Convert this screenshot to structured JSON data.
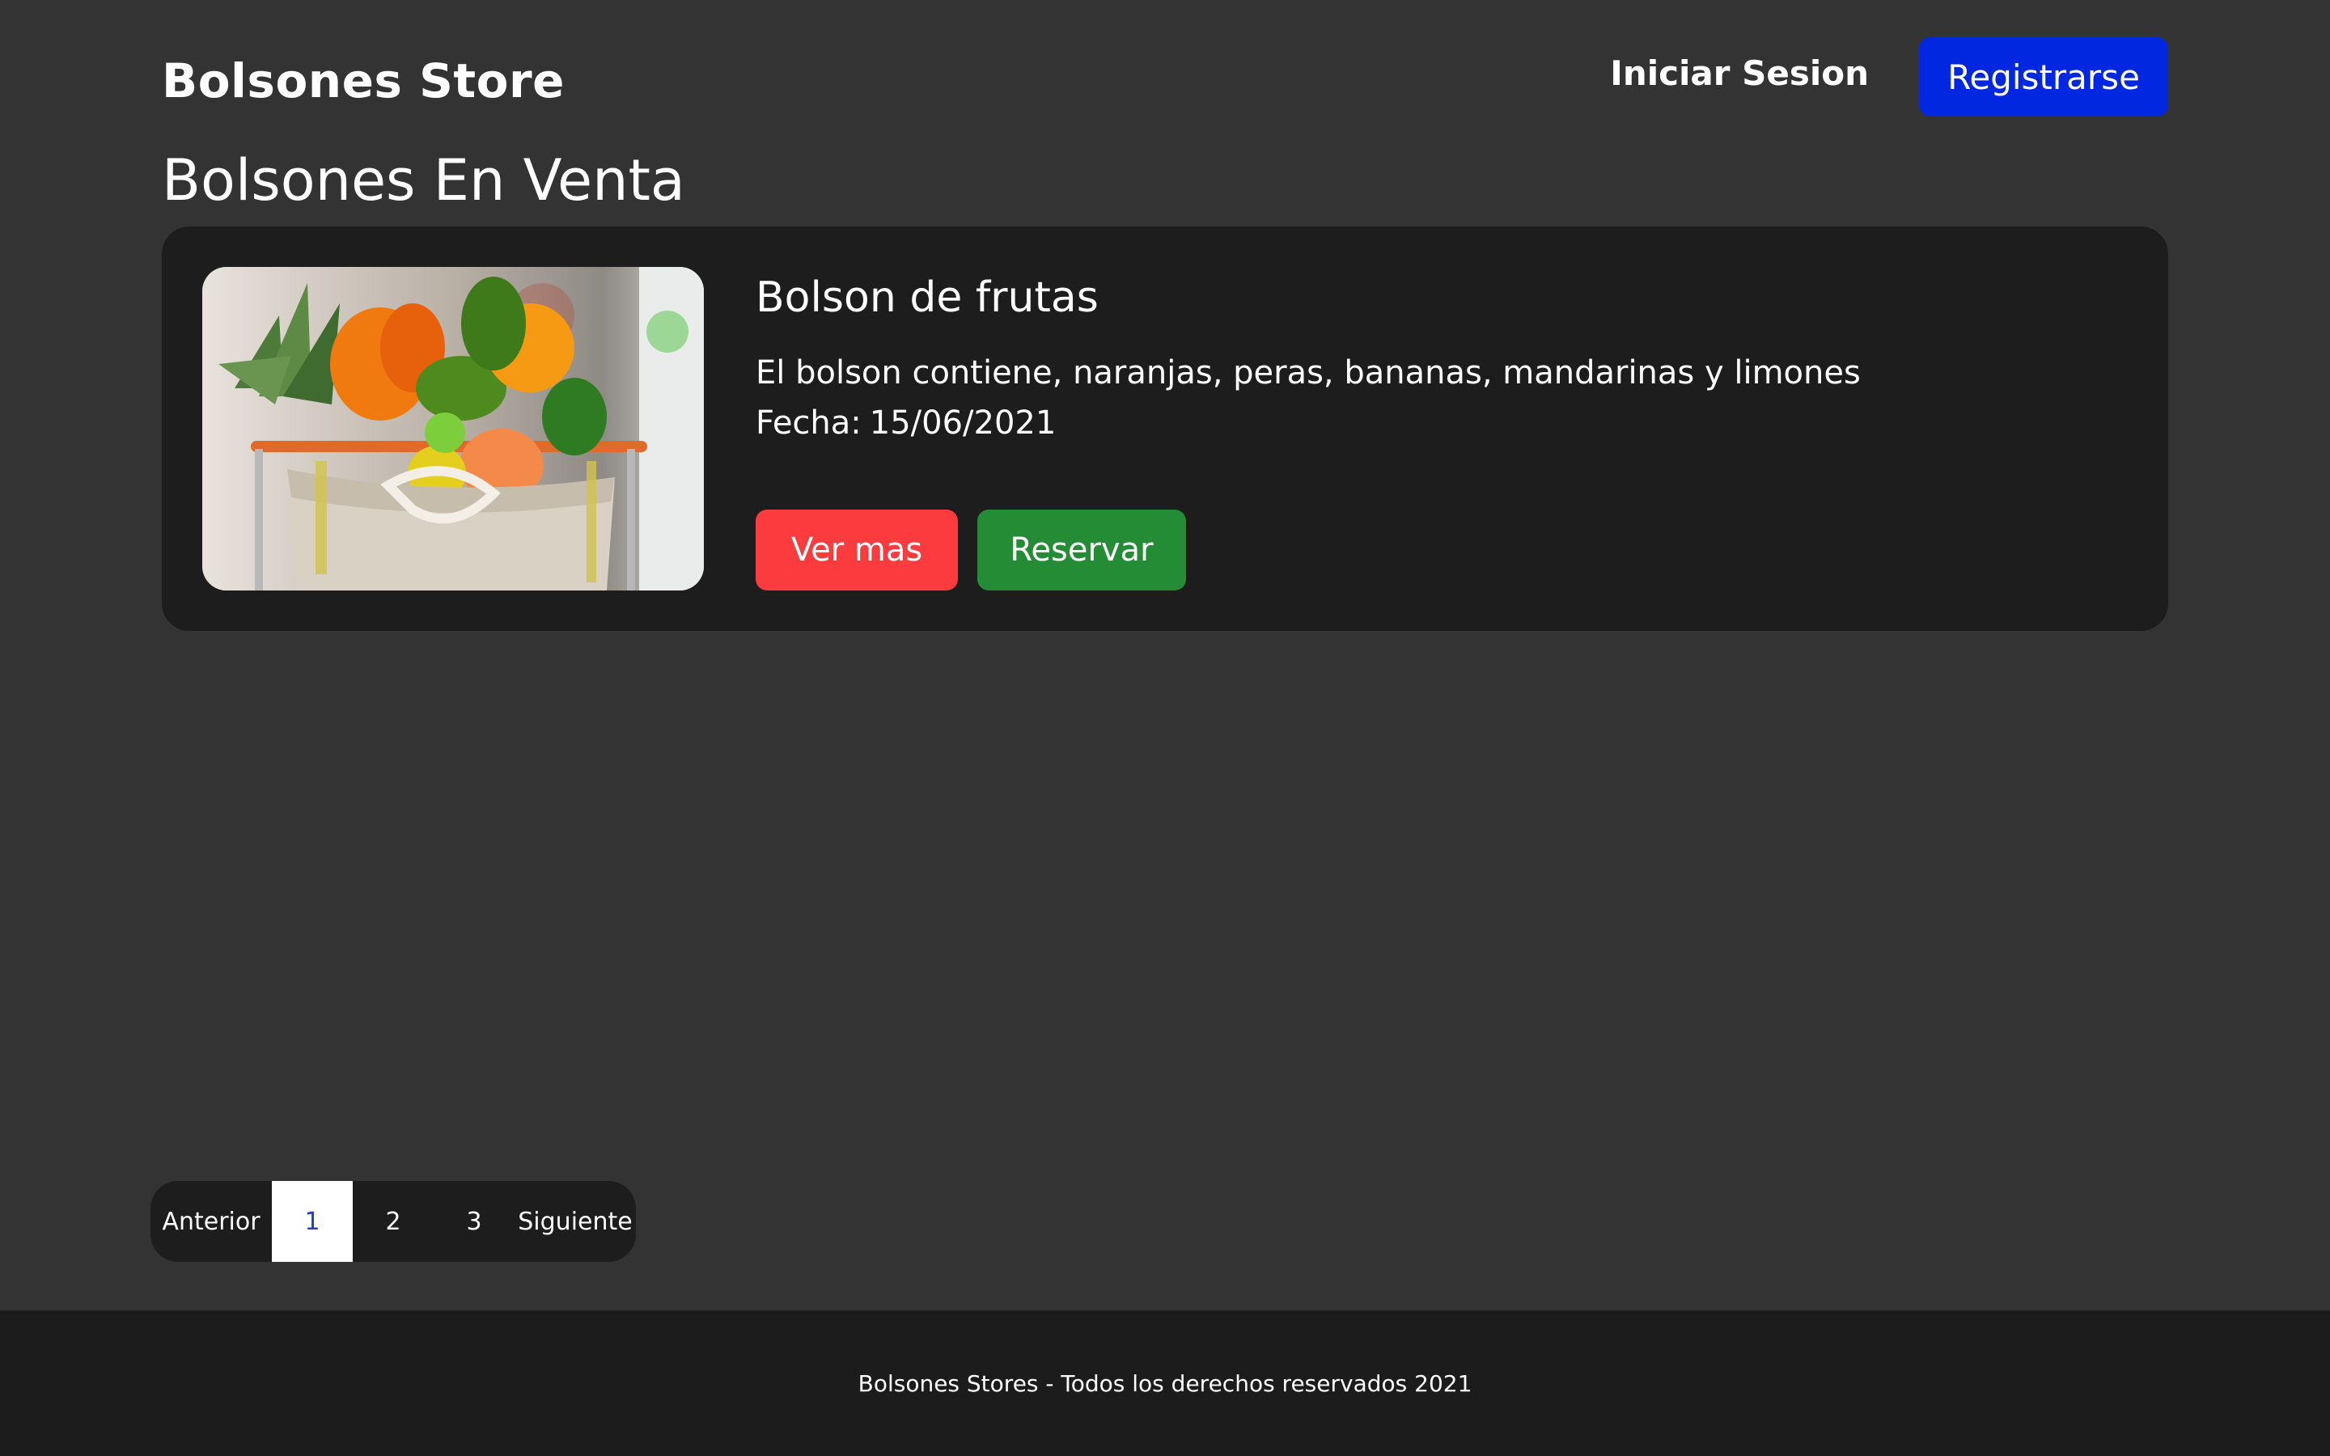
{
  "header": {
    "brand": "Bolsones Store",
    "login_label": "Iniciar Sesion",
    "register_label": "Registrarse"
  },
  "main": {
    "section_title": "Bolsones En Venta",
    "cards": [
      {
        "title": "Bolson de frutas",
        "description": "El bolson contiene, naranjas, peras, bananas, mandarinas y limones",
        "date_label": "Fecha:",
        "date_value": "15/06/2021",
        "more_label": "Ver mas",
        "reserve_label": "Reservar"
      }
    ]
  },
  "pagination": {
    "prev_label": "Anterior",
    "pages": [
      "1",
      "2",
      "3"
    ],
    "active_page": "1",
    "next_label": "Siguiente"
  },
  "footer": {
    "text": "Bolsones Stores - Todos los derechos reservados 2021"
  },
  "colors": {
    "background": "#333333",
    "card": "#1d1d1d",
    "register_button": "#0227e0",
    "more_button": "#fc3b3e",
    "reserve_button": "#258c36",
    "footer": "#1c1c1c",
    "active_page_text": "#1f3fc7"
  }
}
